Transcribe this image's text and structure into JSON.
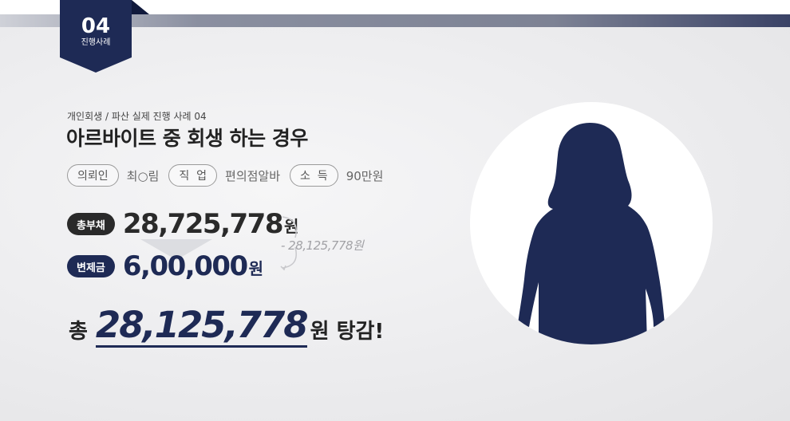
{
  "badge": {
    "number": "04",
    "label": "진행사례"
  },
  "case": {
    "subtitle": "개인회생 / 파산 실제 진행 사례 04",
    "title": "아르바이트 중 회생 하는 경우"
  },
  "info": {
    "client_label": "의뢰인",
    "client_value": "최○림",
    "job_label": "직  업",
    "job_value": "편의점알바",
    "income_label": "소  득",
    "income_value": "90만원"
  },
  "amounts": {
    "debt_label": "총부채",
    "debt_value": "28,725,778",
    "debt_unit": "원",
    "repay_label": "변제금",
    "repay_value": "6,00,000",
    "repay_unit": "원",
    "difference": "- 28,125,778원"
  },
  "total": {
    "prefix": "총",
    "value": "28,125,778",
    "suffix": "원 탕감!"
  },
  "colors": {
    "navy": "#1e2a55",
    "dark": "#2a2a2a"
  },
  "icons": {
    "avatar": "person-silhouette-icon",
    "arrow": "down-arrow-icon"
  }
}
